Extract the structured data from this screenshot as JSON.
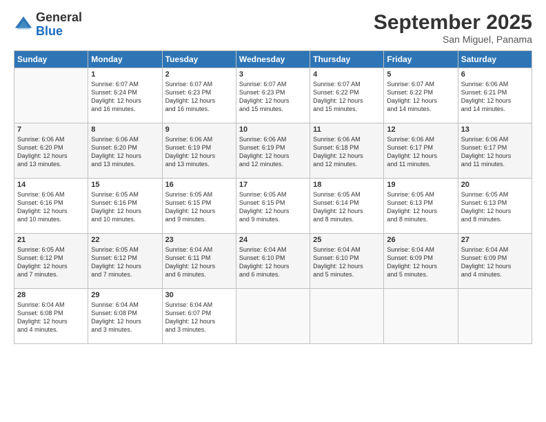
{
  "logo": {
    "line1": "General",
    "line2": "Blue"
  },
  "title": "September 2025",
  "subtitle": "San Miguel, Panama",
  "headers": [
    "Sunday",
    "Monday",
    "Tuesday",
    "Wednesday",
    "Thursday",
    "Friday",
    "Saturday"
  ],
  "weeks": [
    [
      {
        "day": "",
        "info": ""
      },
      {
        "day": "1",
        "info": "Sunrise: 6:07 AM\nSunset: 6:24 PM\nDaylight: 12 hours\nand 16 minutes."
      },
      {
        "day": "2",
        "info": "Sunrise: 6:07 AM\nSunset: 6:23 PM\nDaylight: 12 hours\nand 16 minutes."
      },
      {
        "day": "3",
        "info": "Sunrise: 6:07 AM\nSunset: 6:23 PM\nDaylight: 12 hours\nand 15 minutes."
      },
      {
        "day": "4",
        "info": "Sunrise: 6:07 AM\nSunset: 6:22 PM\nDaylight: 12 hours\nand 15 minutes."
      },
      {
        "day": "5",
        "info": "Sunrise: 6:07 AM\nSunset: 6:22 PM\nDaylight: 12 hours\nand 14 minutes."
      },
      {
        "day": "6",
        "info": "Sunrise: 6:06 AM\nSunset: 6:21 PM\nDaylight: 12 hours\nand 14 minutes."
      }
    ],
    [
      {
        "day": "7",
        "info": "Sunrise: 6:06 AM\nSunset: 6:20 PM\nDaylight: 12 hours\nand 13 minutes."
      },
      {
        "day": "8",
        "info": "Sunrise: 6:06 AM\nSunset: 6:20 PM\nDaylight: 12 hours\nand 13 minutes."
      },
      {
        "day": "9",
        "info": "Sunrise: 6:06 AM\nSunset: 6:19 PM\nDaylight: 12 hours\nand 13 minutes."
      },
      {
        "day": "10",
        "info": "Sunrise: 6:06 AM\nSunset: 6:19 PM\nDaylight: 12 hours\nand 12 minutes."
      },
      {
        "day": "11",
        "info": "Sunrise: 6:06 AM\nSunset: 6:18 PM\nDaylight: 12 hours\nand 12 minutes."
      },
      {
        "day": "12",
        "info": "Sunrise: 6:06 AM\nSunset: 6:17 PM\nDaylight: 12 hours\nand 11 minutes."
      },
      {
        "day": "13",
        "info": "Sunrise: 6:06 AM\nSunset: 6:17 PM\nDaylight: 12 hours\nand 11 minutes."
      }
    ],
    [
      {
        "day": "14",
        "info": "Sunrise: 6:06 AM\nSunset: 6:16 PM\nDaylight: 12 hours\nand 10 minutes."
      },
      {
        "day": "15",
        "info": "Sunrise: 6:05 AM\nSunset: 6:16 PM\nDaylight: 12 hours\nand 10 minutes."
      },
      {
        "day": "16",
        "info": "Sunrise: 6:05 AM\nSunset: 6:15 PM\nDaylight: 12 hours\nand 9 minutes."
      },
      {
        "day": "17",
        "info": "Sunrise: 6:05 AM\nSunset: 6:15 PM\nDaylight: 12 hours\nand 9 minutes."
      },
      {
        "day": "18",
        "info": "Sunrise: 6:05 AM\nSunset: 6:14 PM\nDaylight: 12 hours\nand 8 minutes."
      },
      {
        "day": "19",
        "info": "Sunrise: 6:05 AM\nSunset: 6:13 PM\nDaylight: 12 hours\nand 8 minutes."
      },
      {
        "day": "20",
        "info": "Sunrise: 6:05 AM\nSunset: 6:13 PM\nDaylight: 12 hours\nand 8 minutes."
      }
    ],
    [
      {
        "day": "21",
        "info": "Sunrise: 6:05 AM\nSunset: 6:12 PM\nDaylight: 12 hours\nand 7 minutes."
      },
      {
        "day": "22",
        "info": "Sunrise: 6:05 AM\nSunset: 6:12 PM\nDaylight: 12 hours\nand 7 minutes."
      },
      {
        "day": "23",
        "info": "Sunrise: 6:04 AM\nSunset: 6:11 PM\nDaylight: 12 hours\nand 6 minutes."
      },
      {
        "day": "24",
        "info": "Sunrise: 6:04 AM\nSunset: 6:10 PM\nDaylight: 12 hours\nand 6 minutes."
      },
      {
        "day": "25",
        "info": "Sunrise: 6:04 AM\nSunset: 6:10 PM\nDaylight: 12 hours\nand 5 minutes."
      },
      {
        "day": "26",
        "info": "Sunrise: 6:04 AM\nSunset: 6:09 PM\nDaylight: 12 hours\nand 5 minutes."
      },
      {
        "day": "27",
        "info": "Sunrise: 6:04 AM\nSunset: 6:09 PM\nDaylight: 12 hours\nand 4 minutes."
      }
    ],
    [
      {
        "day": "28",
        "info": "Sunrise: 6:04 AM\nSunset: 6:08 PM\nDaylight: 12 hours\nand 4 minutes."
      },
      {
        "day": "29",
        "info": "Sunrise: 6:04 AM\nSunset: 6:08 PM\nDaylight: 12 hours\nand 3 minutes."
      },
      {
        "day": "30",
        "info": "Sunrise: 6:04 AM\nSunset: 6:07 PM\nDaylight: 12 hours\nand 3 minutes."
      },
      {
        "day": "",
        "info": ""
      },
      {
        "day": "",
        "info": ""
      },
      {
        "day": "",
        "info": ""
      },
      {
        "day": "",
        "info": ""
      }
    ]
  ]
}
